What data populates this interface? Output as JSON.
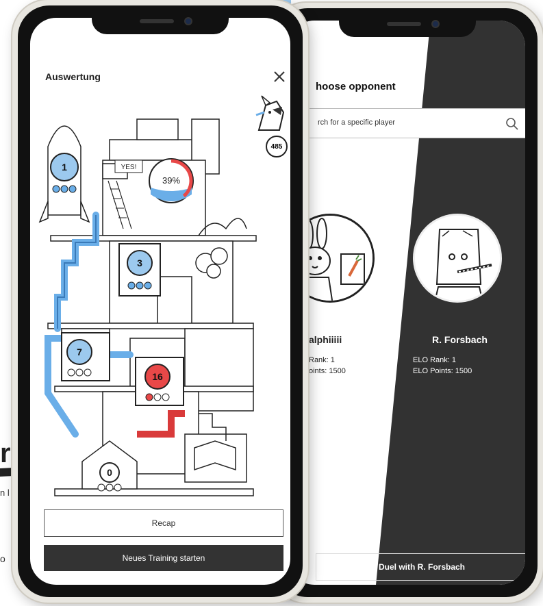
{
  "background": {
    "big_text": "ra",
    "small_text_1": "n l",
    "small_text_2": "o"
  },
  "front_screen": {
    "title": "Auswertung",
    "score_badge": "485",
    "progress_percent_label": "39%",
    "progress_value": 0.39,
    "nodes": [
      {
        "label": "1",
        "color": "#6aaee8"
      },
      {
        "label": "3",
        "color": "#6aaee8"
      },
      {
        "label": "7",
        "color": "#6aaee8"
      },
      {
        "label": "16",
        "color": "#e84848"
      },
      {
        "label": "0",
        "color": "#ffffff"
      }
    ],
    "sign_text": "YES!",
    "buttons": {
      "recap": "Recap",
      "start_training": "Neues Training starten"
    }
  },
  "back_screen": {
    "title": "hoose opponent",
    "search_placeholder": "rch for a specific player",
    "players": [
      {
        "name": "alphiiiii",
        "elo_rank": "Rank: 1",
        "elo_points": "oints: 1500"
      },
      {
        "name": "R. Forsbach",
        "elo_rank": "ELO Rank: 1",
        "elo_points": "ELO Points: 1500"
      }
    ],
    "duel_button": "Duel with R. Forsbach"
  },
  "colors": {
    "accent_blue": "#6aaee8",
    "accent_red": "#e84848",
    "dark_panel": "#323232"
  }
}
